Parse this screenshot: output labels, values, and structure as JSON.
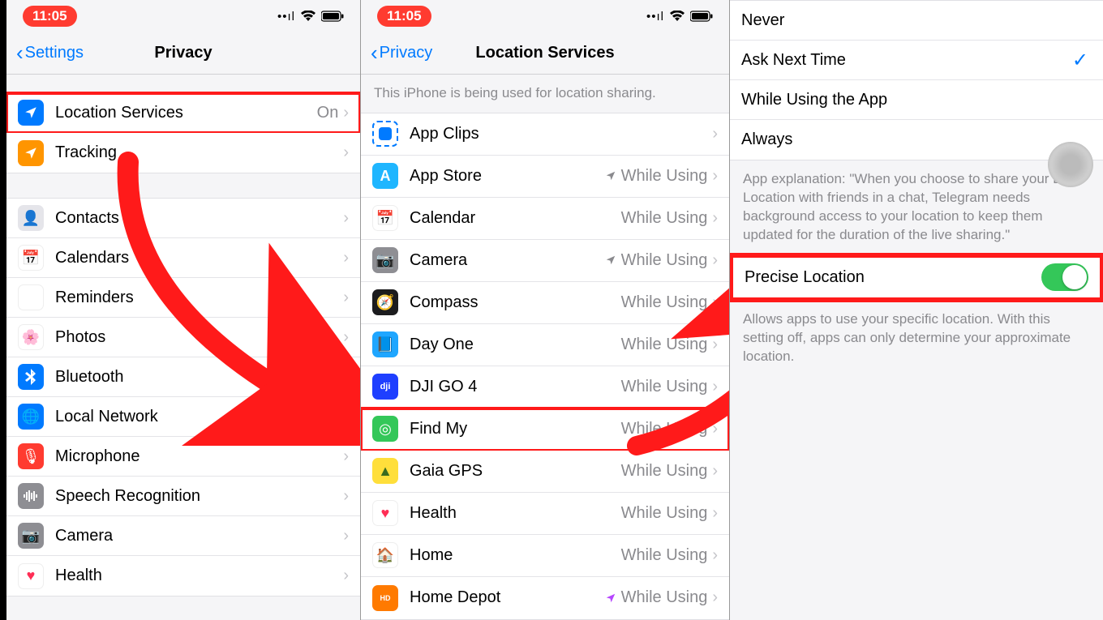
{
  "statusbar": {
    "time": "11:05"
  },
  "panel1": {
    "back": "Settings",
    "title": "Privacy",
    "groupA": [
      {
        "label": "Location Services",
        "value": "On",
        "highlight": true
      },
      {
        "label": "Tracking",
        "value": ""
      }
    ],
    "groupB": [
      {
        "label": "Contacts"
      },
      {
        "label": "Calendars"
      },
      {
        "label": "Reminders"
      },
      {
        "label": "Photos"
      },
      {
        "label": "Bluetooth"
      },
      {
        "label": "Local Network"
      },
      {
        "label": "Microphone"
      },
      {
        "label": "Speech Recognition"
      },
      {
        "label": "Camera"
      },
      {
        "label": "Health"
      }
    ]
  },
  "panel2": {
    "back": "Privacy",
    "title": "Location Services",
    "header": "This iPhone is being used for location sharing.",
    "apps": [
      {
        "label": "App Clips",
        "value": "",
        "arrow": ""
      },
      {
        "label": "App Store",
        "value": "While Using",
        "arrow": "grey"
      },
      {
        "label": "Calendar",
        "value": "While Using",
        "arrow": ""
      },
      {
        "label": "Camera",
        "value": "While Using",
        "arrow": "grey"
      },
      {
        "label": "Compass",
        "value": "While Using",
        "arrow": ""
      },
      {
        "label": "Day One",
        "value": "While Using",
        "arrow": ""
      },
      {
        "label": "DJI GO 4",
        "value": "While Using",
        "arrow": ""
      },
      {
        "label": "Find My",
        "value": "While Using",
        "arrow": "",
        "highlight": true
      },
      {
        "label": "Gaia GPS",
        "value": "While Using",
        "arrow": ""
      },
      {
        "label": "Health",
        "value": "While Using",
        "arrow": ""
      },
      {
        "label": "Home",
        "value": "While Using",
        "arrow": ""
      },
      {
        "label": "Home Depot",
        "value": "While Using",
        "arrow": "purple"
      }
    ]
  },
  "panel3": {
    "options": [
      {
        "label": "Never",
        "selected": false
      },
      {
        "label": "Ask Next Time",
        "selected": true
      },
      {
        "label": "While Using the App",
        "selected": false
      },
      {
        "label": "Always",
        "selected": false
      }
    ],
    "explanation": "App explanation: \"When you choose to share your Live Location with friends in a chat, Telegram needs background access to your location to keep them updated for the duration of the live sharing.\"",
    "precise": {
      "label": "Precise Location",
      "on": true,
      "highlight": true
    },
    "precise_footer": "Allows apps to use your specific location. With this setting off, apps can only determine your approximate location."
  }
}
